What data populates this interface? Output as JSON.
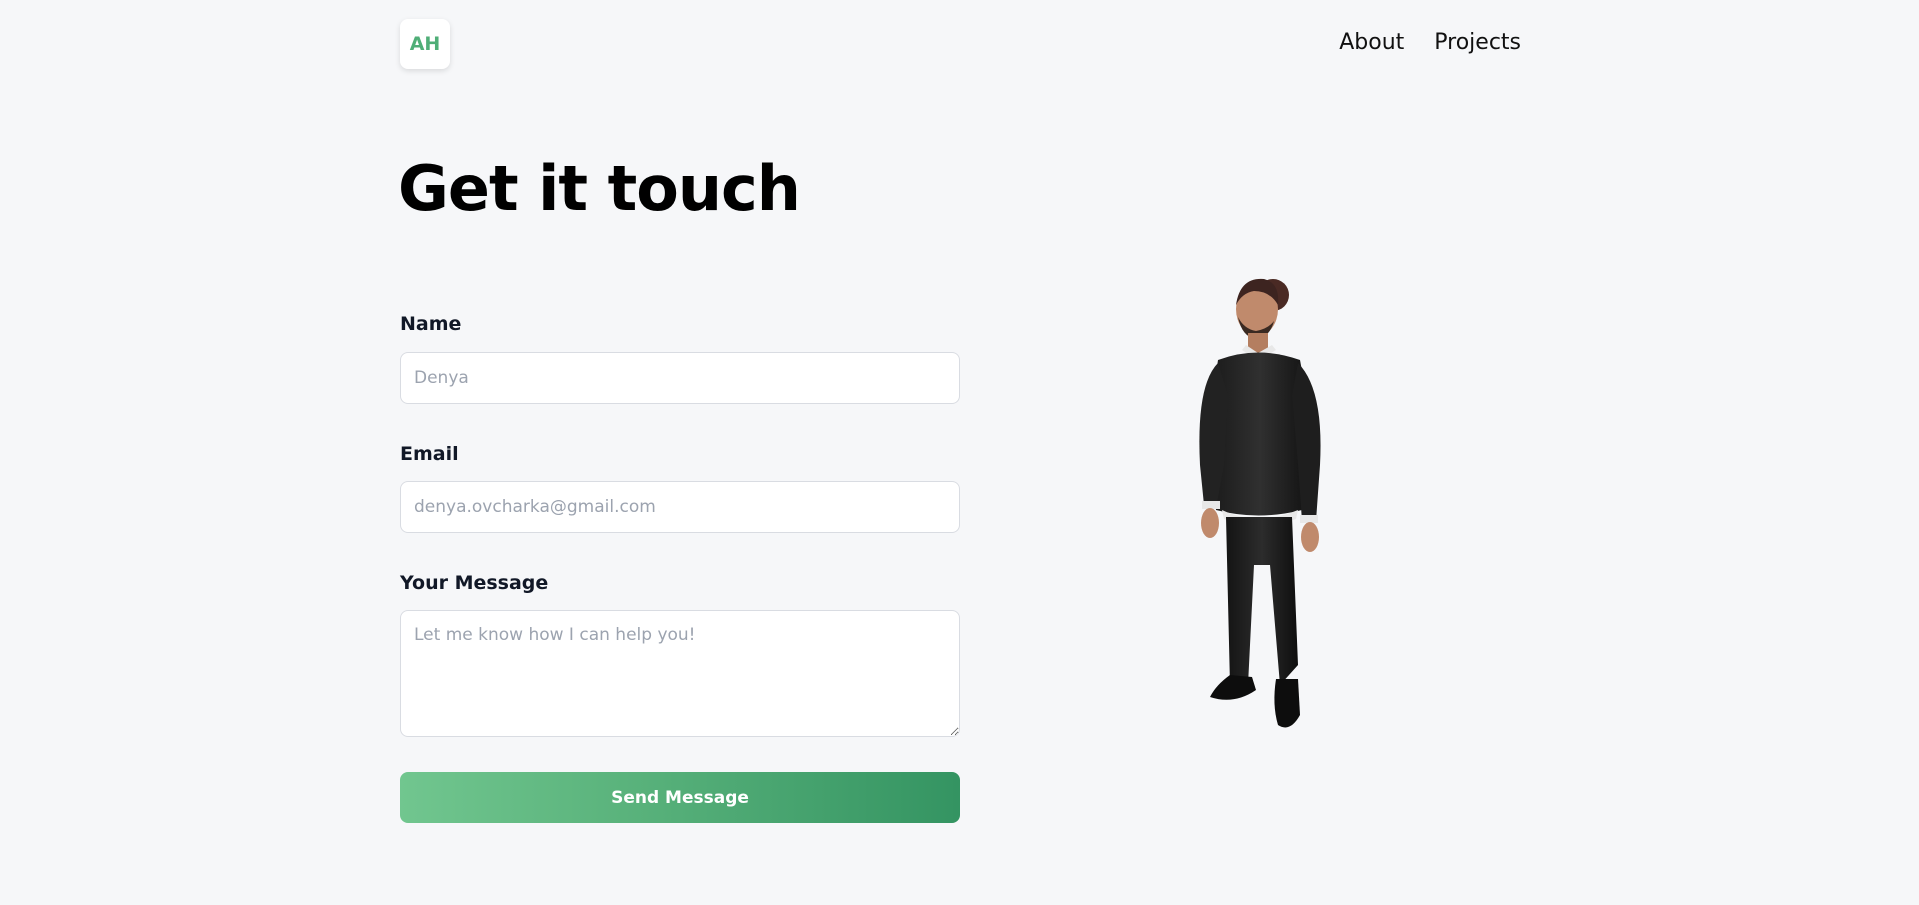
{
  "header": {
    "logo_text": "AH",
    "nav": [
      {
        "label": "About"
      },
      {
        "label": "Projects"
      }
    ]
  },
  "main": {
    "title": "Get it touch",
    "form": {
      "name": {
        "label": "Name",
        "placeholder": "Denya",
        "value": ""
      },
      "email": {
        "label": "Email",
        "placeholder": "denya.ovcharka@gmail.com",
        "value": ""
      },
      "message": {
        "label": "Your Message",
        "placeholder": "Let me know how I can help you!",
        "value": ""
      },
      "submit_label": "Send Message"
    }
  },
  "colors": {
    "background": "#f6f7f9",
    "accent": "#4fae77",
    "button_gradient_start": "#71c68f",
    "button_gradient_end": "#349462"
  }
}
